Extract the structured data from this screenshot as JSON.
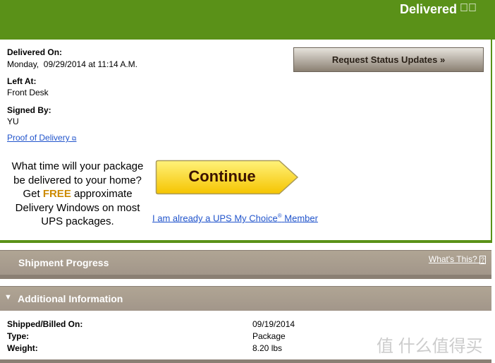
{
  "header": {
    "status": "Delivered",
    "status_icon": "check-circle-icon",
    "color": "#5a9118"
  },
  "delivery": {
    "delivered_on_label": "Delivered On:",
    "delivered_on": "Monday,  09/29/2014 at 11:14 A.M.",
    "left_at_label": "Left At:",
    "left_at": "Front Desk",
    "signed_by_label": "Signed By:",
    "signed_by": "YU",
    "proof_link": "Proof of Delivery"
  },
  "request_button": "Request Status Updates »",
  "promo": {
    "line1": "What time will your package be delivered to your home?",
    "get": "Get",
    "free": "FREE",
    "rest": "approximate Delivery Windows on most UPS packages.",
    "continue": "Continue",
    "member_link": "I am already a UPS My Choice",
    "member_reg": "®",
    "member_tail": "Member"
  },
  "shipment_progress": {
    "title": "Shipment Progress",
    "whats_this": "What's This?"
  },
  "additional": {
    "title": "Additional Information",
    "rows": [
      {
        "label": "Shipped/Billed On:",
        "value": "09/19/2014"
      },
      {
        "label": "Type:",
        "value": "Package"
      },
      {
        "label": "Weight:",
        "value": "8.20 lbs"
      }
    ]
  },
  "watermark": "值 什么值得买"
}
